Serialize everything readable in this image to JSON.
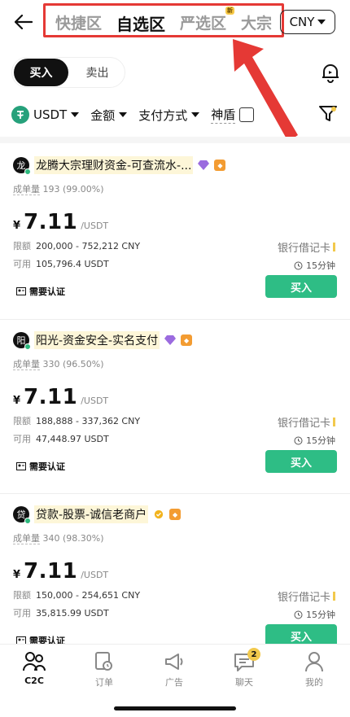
{
  "header": {
    "tabs": [
      {
        "label": "快捷区",
        "active": false
      },
      {
        "label": "自选区",
        "active": true
      },
      {
        "label": "严选区",
        "active": false,
        "badge": "新"
      },
      {
        "label": "大宗",
        "active": false
      }
    ],
    "currency": "CNY"
  },
  "trade_toggle": {
    "buy": "买入",
    "sell": "卖出"
  },
  "filters": {
    "coin": "USDT",
    "amount": "金额",
    "payment": "支付方式",
    "shield": "神盾"
  },
  "listings": [
    {
      "avatar": "龙",
      "name": "龙腾大宗理财资金-可查流水-...",
      "trades_label": "成单量",
      "trades": "193 (99.00%)",
      "currency_symbol": "¥",
      "price": "7.11",
      "unit": "/USDT",
      "limit_label": "限额",
      "limit": "200,000 - 752,212 CNY",
      "avail_label": "可用",
      "avail": "105,796.4 USDT",
      "verify": "需要认证",
      "payment": "银行借记卡",
      "time": "15分钟",
      "buy": "买入"
    },
    {
      "avatar": "阳",
      "name": "阳光-资金安全-实名支付",
      "trades_label": "成单量",
      "trades": "330 (96.50%)",
      "currency_symbol": "¥",
      "price": "7.11",
      "unit": "/USDT",
      "limit_label": "限额",
      "limit": "188,888 - 337,362 CNY",
      "avail_label": "可用",
      "avail": "47,448.97 USDT",
      "verify": "需要认证",
      "payment": "银行借记卡",
      "time": "15分钟",
      "buy": "买入"
    },
    {
      "avatar": "贷",
      "name": "贷款-股票-诚信老商户",
      "trades_label": "成单量",
      "trades": "340 (98.30%)",
      "currency_symbol": "¥",
      "price": "7.11",
      "unit": "/USDT",
      "limit_label": "限额",
      "limit": "150,000 - 254,651 CNY",
      "avail_label": "可用",
      "avail": "35,815.99 USDT",
      "verify": "需要认证",
      "payment": "银行借记卡",
      "time": "15分钟",
      "buy": "买入"
    }
  ],
  "bottom_nav": [
    {
      "label": "C2C",
      "active": true
    },
    {
      "label": "订单",
      "active": false
    },
    {
      "label": "广告",
      "active": false
    },
    {
      "label": "聊天",
      "active": false,
      "badge": "2"
    },
    {
      "label": "我的",
      "active": false
    }
  ],
  "colors": {
    "buy_green": "#2ebd85",
    "highlight_red": "#e53935",
    "tether_green": "#26a17b"
  }
}
